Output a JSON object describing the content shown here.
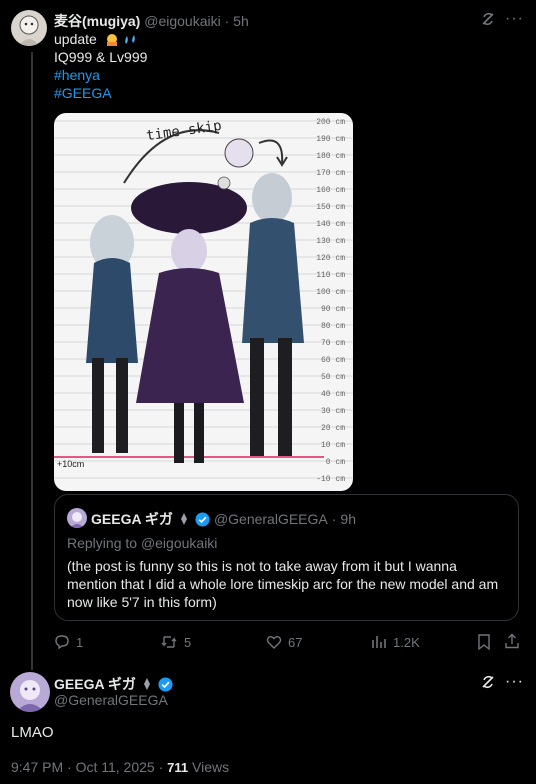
{
  "post": {
    "author_name": "麦谷(mugiya)",
    "handle": "@eigoukaiki",
    "dot": "·",
    "time": "5h",
    "line1": "update",
    "line2": "IQ999 & Lv999",
    "hashtag1": "#henya",
    "hashtag2": "#GEEGA",
    "image": {
      "annotation": "time skip",
      "ruler_labels": [
        "200 cm",
        "190 cm",
        "180 cm",
        "170 cm",
        "160 cm",
        "150 cm",
        "140 cm",
        "130 cm",
        "120 cm",
        "110 cm",
        "100 cm",
        "90 cm",
        "80 cm",
        "70 cm",
        "60 cm",
        "50 cm",
        "40 cm",
        "30 cm",
        "20 cm",
        "10 cm",
        "0 cm",
        "-10 cm"
      ],
      "scale_note": "+10cm"
    },
    "quote": {
      "author_name": "GEEGA ギガ",
      "handle": "@GeneralGEEGA",
      "dot": "·",
      "time": "9h",
      "replying_prefix": "Replying to ",
      "replying_handle": "@eigoukaiki",
      "text": "(the post is funny so this is not to take away from it but I wanna mention that I did a whole lore timeskip arc for the new model and am now like 5'7 in this form)"
    },
    "actions": {
      "replies": "1",
      "reposts": "5",
      "likes": "67",
      "views": "1.2K"
    }
  },
  "reply": {
    "author_name": "GEEGA ギガ",
    "handle": "@GeneralGEEGA",
    "text": "LMAO",
    "time": "9:47 PM · Oct 11, 2025 · ",
    "views_count": "711",
    "views_label": " Views"
  },
  "colors": {
    "accent": "#1d9bf0",
    "muted": "#71767b",
    "border": "#2f3336",
    "height_line": "#e0245e"
  }
}
